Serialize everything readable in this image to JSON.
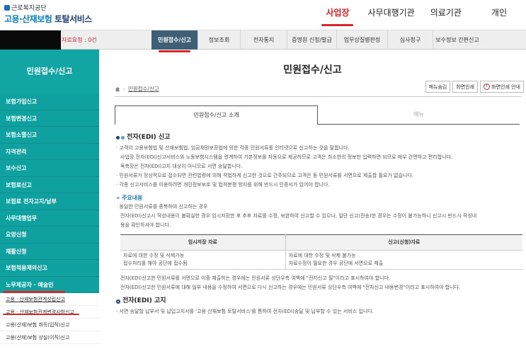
{
  "header": {
    "org": "근로복지공단",
    "title_prefix": "고용·산재보험",
    "title_suffix": " 토탈서비스",
    "nav": [
      "사업장",
      "사무대행기관",
      "의료기관",
      "개인"
    ]
  },
  "menubar": {
    "request": "자료요청 : 0건",
    "items": [
      "민원접수/신고",
      "정보조회",
      "전자통지",
      "증명원 신청/발급",
      "업무상질병판정",
      "심사청구",
      "보수정보 간편신고"
    ]
  },
  "sidebar": {
    "title": "민원접수/신고",
    "items": [
      "보험가입신고",
      "보험변경신고",
      "보험소멸신고",
      "자격관리",
      "보수신고",
      "보험료신고",
      "보험료 전자고지/납부",
      "사무대행업무",
      "요양신청",
      "재활신청",
      "보험적용제외신고",
      "노무제공자 · 예술인"
    ],
    "subs": [
      "고용 · 산재보험관계성립신고",
      "고용 · 산재보험관계변경사항신고",
      "고용(산재)보험 취득(입직)신고",
      "고용(산재)보험 상실(이직)신고"
    ]
  },
  "content": {
    "title": "민원접수/신고",
    "breadcrumb": "민원접수/신고",
    "utils": [
      "메뉴숨김",
      "화면인쇄",
      "화면인쇄 안내"
    ],
    "tabs": [
      "민원접수/신고 소개",
      "메뉴"
    ],
    "edi_title": "전자(EDI) 신고",
    "edi_lines": [
      "· 고객이 고용보험법 및 산재보험법, 임금채권보장법에 의한 각종 민원서류를 인터넷으로 신고하는 것을 말합니다.",
      "사업장 전자(EDI)신고서비스와 노동보험시스템을 연계하여 기본정보를 자동으로 제공하므로 고객은 최소한의 정보만 입력하면 되므로 매우 간편하고 편리합니다.",
      "독촉장은 전자(EDI)고지 대상이 아니므로 서면 송달합니다.",
      "· 민원서류가 정상적으로 접수되면 관련법령에 의해 적법하게 신고한 것으로 간주되므로 고객은 동 민원서류를 서면으로 제출할 필요가 없습니다.",
      "· 각종 신고서비스를 이용하려면 개인정보보호 및 법적분쟁 방지를 위해 반드시 인증서가 있어야 합니다."
    ],
    "notice_title": "주요내용",
    "notice_lines": [
      "· 동일한 민원서류를 중복하여 신고하는 경우",
      "전자(EDI)신고시 작성내용이 불확실한 경우 임시저장한 후 추후 자료를 수정, 보완하여 신고할 수 있으나, 일단 신고(전송)한 경우는 수정이 불가능하니 신고시 반드시 작성내",
      "용을 확인하셔야 합니다."
    ],
    "table": {
      "headers": [
        "임시저장 자료",
        "신고(신청)자료"
      ],
      "col1": [
        "자료에 대한 수정 및 삭제가능",
        "접수처리를 해야 공단에 접수됨"
      ],
      "col2": [
        "자료에 대한 수정 및 삭제 불가능",
        "자료수정이 필요한 경우 공단에 서면으로 제출"
      ]
    },
    "after_lines": [
      "전자(EDI)신고한 민원서류를 서면으로 이중 제출하는 경우에는 민원서류 상단우측 여백에 \"전자신고 필\"이라고 표시하여야 합니다.",
      "전자(EDI)신고한 민원서류에 대해 일부 내용을 수정하여 서면으로 다시 신고하는 경우에는 민원서류 상단우측 여백에 \"전자신고 내용변경\"이라고 표시하여야 합니다."
    ],
    "edi2_title": "전자(EDI) 고지",
    "edi2_lines": [
      "· 서면 송달할 납부서 및 납입고지서를 '고용·산재보험 토탈서비스'를 통하여 전자(EDI)송달 및 납부할 수 있는 서비스 입니다."
    ]
  }
}
